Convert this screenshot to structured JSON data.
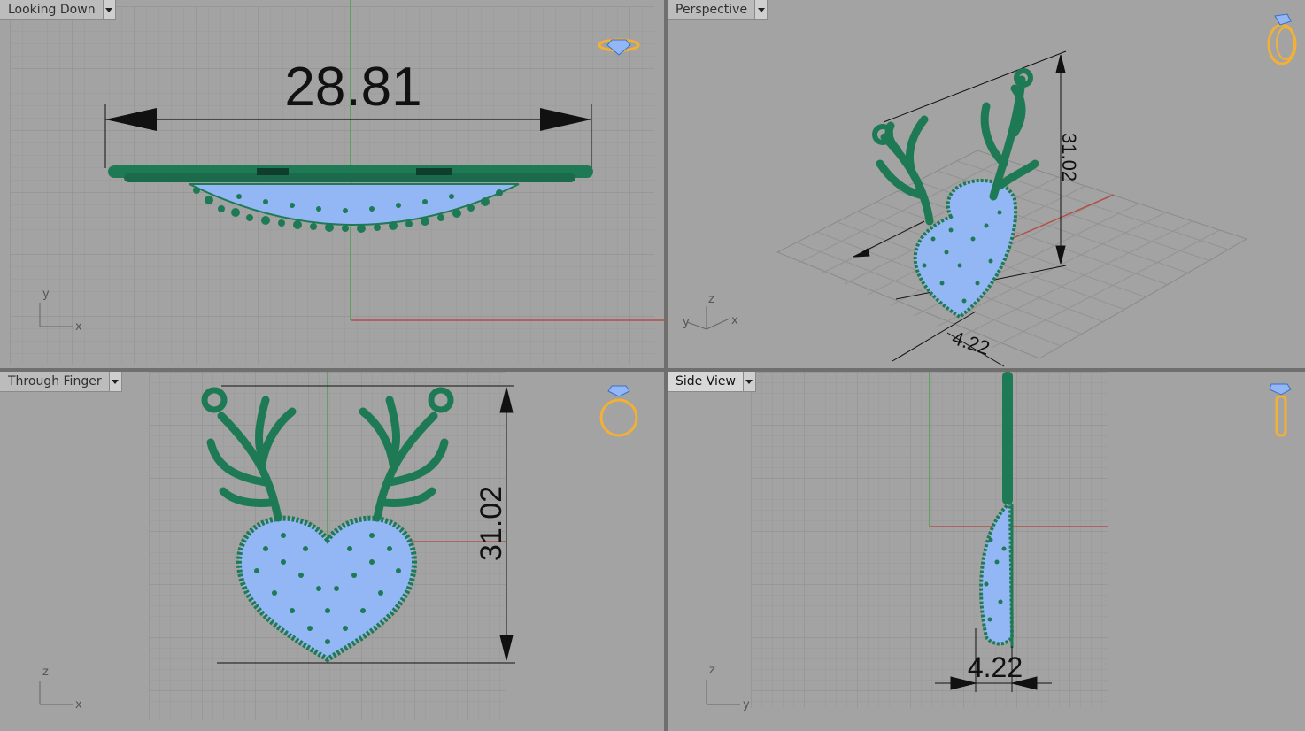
{
  "viewports": {
    "top_left": {
      "label": "Looking Down",
      "active": false,
      "axes": {
        "a": "y",
        "b": "x"
      },
      "dimension": "28.81"
    },
    "top_right": {
      "label": "Perspective",
      "active": false,
      "axes": {
        "a": "z",
        "b": "x",
        "c": "y"
      },
      "dimensions": {
        "height": "31.02",
        "depth": "4.22"
      }
    },
    "bottom_left": {
      "label": "Through Finger",
      "active": false,
      "axes": {
        "a": "z",
        "b": "x"
      },
      "dimension": "31.02"
    },
    "bottom_right": {
      "label": "Side View",
      "active": true,
      "axes": {
        "a": "z",
        "b": "y"
      },
      "dimension": "4.22"
    }
  },
  "colors": {
    "viewport_bg": "#a3a3a3",
    "grid_minor": "#999999",
    "grid_major": "#8f8f8f",
    "x_axis": "#b3504a",
    "y_axis": "#4a9f4a",
    "metal": "#1e7a55",
    "stones": "#93b7f4",
    "widget": "#f2b035"
  },
  "icons": [
    "ring-top-view-icon",
    "ring-perspective-icon",
    "ring-front-icon",
    "ring-side-icon",
    "axis-triad-icon",
    "dropdown-arrow-icon"
  ]
}
